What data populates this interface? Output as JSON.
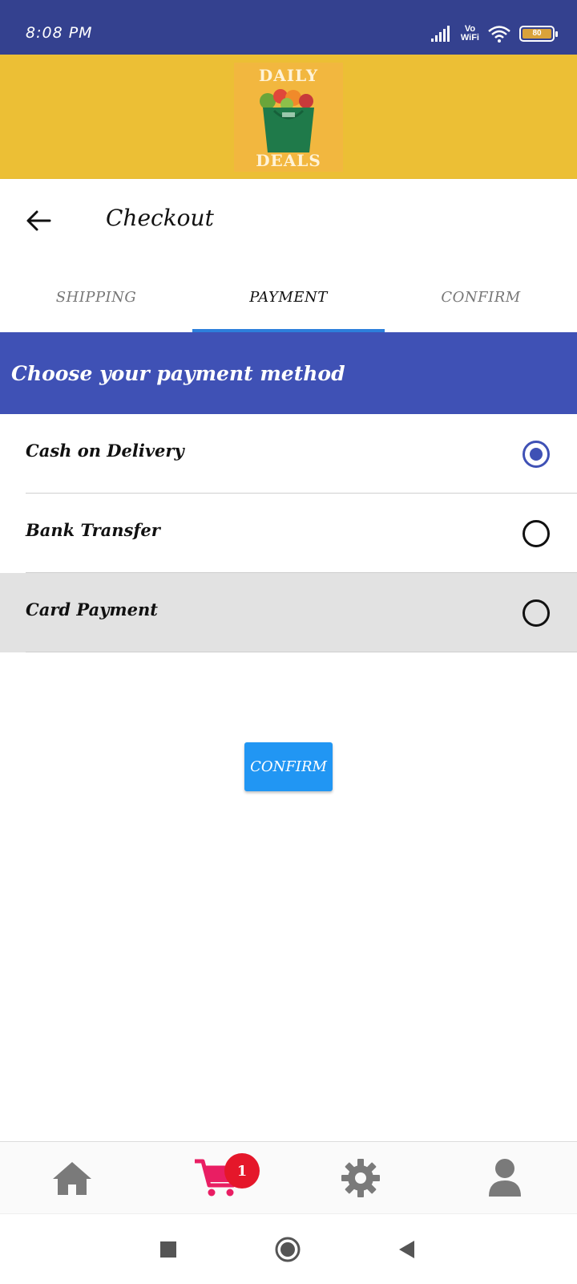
{
  "status_bar": {
    "time": "8:08 PM",
    "network_label_top": "Vo",
    "network_label_bottom": "WiFi",
    "battery_level": "80"
  },
  "banner": {
    "logo_top": "DAILY",
    "logo_bottom": "DEALS"
  },
  "appbar": {
    "title": "Checkout"
  },
  "tabs": [
    {
      "label": "SHIPPING",
      "active": false
    },
    {
      "label": "PAYMENT",
      "active": true
    },
    {
      "label": "CONFIRM",
      "active": false
    }
  ],
  "section": {
    "header": "Choose your payment method"
  },
  "payment_options": [
    {
      "label": "Cash on Delivery",
      "selected": true
    },
    {
      "label": "Bank Transfer",
      "selected": false
    },
    {
      "label": "Card Payment",
      "selected": false
    }
  ],
  "actions": {
    "confirm_label": "CONFIRM"
  },
  "bottom_nav": {
    "items": [
      {
        "icon": "home-icon",
        "color": "#7a7a7a"
      },
      {
        "icon": "cart-icon",
        "color": "#e91e63",
        "badge": "1"
      },
      {
        "icon": "gear-icon",
        "color": "#7a7a7a"
      },
      {
        "icon": "user-icon",
        "color": "#7a7a7a"
      }
    ]
  },
  "system_nav": {
    "items": [
      "recents-icon",
      "home-circle-icon",
      "back-triangle-icon"
    ]
  },
  "colors": {
    "status_bar": "#34418f",
    "banner": "#ecbf35",
    "header": "#3f51b5",
    "tab_indicator": "#2d7fdb",
    "confirm_button": "#2196f3",
    "badge": "#e5172a",
    "cart": "#e91e63"
  }
}
